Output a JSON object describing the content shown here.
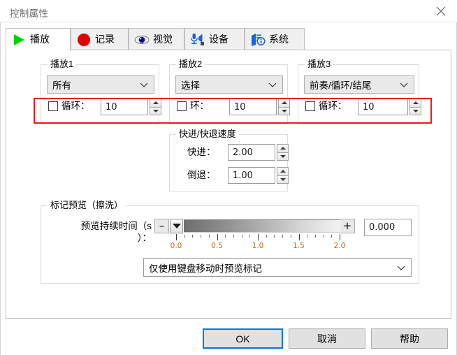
{
  "window": {
    "title": "控制属性",
    "close_icon": "close-icon"
  },
  "tabs": [
    {
      "label": "播放",
      "icon": "play-triangle-icon",
      "active": true
    },
    {
      "label": "记录",
      "icon": "record-circle-icon",
      "active": false
    },
    {
      "label": "视觉",
      "icon": "eye-icon",
      "active": false
    },
    {
      "label": "设备",
      "icon": "microphone-speaker-icon",
      "active": false
    },
    {
      "label": "系统",
      "icon": "system-info-icon",
      "active": false
    }
  ],
  "playback_groups": [
    {
      "title": "播放1",
      "mode_value": "所有",
      "loop_label": "循环：",
      "loop_checked": false,
      "loop_value": "10"
    },
    {
      "title": "播放2",
      "mode_value": "选择",
      "loop_label": "环：",
      "loop_checked": false,
      "loop_value": "10"
    },
    {
      "title": "播放3",
      "mode_value": "前奏/循环/结尾",
      "loop_label": "循环：",
      "loop_checked": false,
      "loop_value": "10"
    }
  ],
  "speed_group": {
    "title": "快进/快退速度",
    "forward_label": "快进：",
    "forward_value": "2.00",
    "rewind_label": "倒退：",
    "rewind_value": "1.00"
  },
  "preview_group": {
    "title": "标记预览（擦洗）",
    "duration_label_line1": "预览持续时间（s",
    "duration_label_line2": "）：",
    "minus_label": "–",
    "plus_label": "+",
    "duration_value": "0.000",
    "slider": {
      "min": 0.0,
      "max": 2.0,
      "value": 0.0,
      "tick_labels": [
        "0.0",
        "0.5",
        "1.0",
        "1.5",
        "2.0"
      ],
      "tick_values": [
        0.0,
        0.5,
        1.0,
        1.5,
        2.0
      ],
      "minor_step": 0.1
    },
    "mode_value": "仅使用键盘移动时预览标记"
  },
  "footer": {
    "ok_label": "OK",
    "cancel_label": "取消",
    "help_label": "帮助"
  },
  "annotation": {
    "highlight_color": "#e02020"
  }
}
